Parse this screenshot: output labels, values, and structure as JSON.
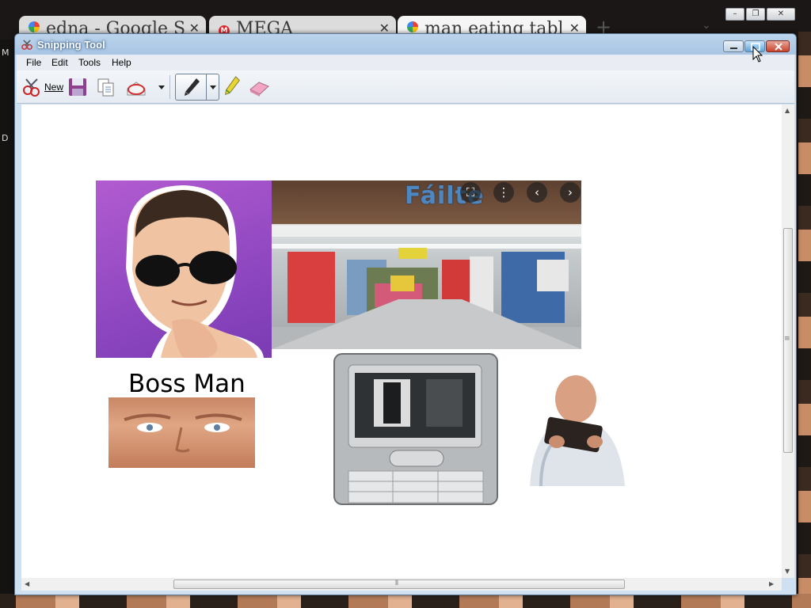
{
  "browser": {
    "tabs": [
      {
        "label": "edna - Google S",
        "icon": "google-icon"
      },
      {
        "label": "MEGA",
        "icon": "mega-icon"
      },
      {
        "label": "man eating tabl",
        "icon": "google-icon",
        "active": true
      }
    ],
    "new_tab": "+",
    "side_letters": [
      "M",
      "D"
    ]
  },
  "window": {
    "title": "Snipping Tool",
    "menu": [
      "File",
      "Edit",
      "Tools",
      "Help"
    ],
    "toolbar": {
      "new_label": "New"
    }
  },
  "canvas": {
    "store_sign_text": "Fáilte",
    "boss_caption": "Boss Man"
  },
  "colors": {
    "title_bar": "#a9c5e3",
    "purple_bg": "#9a4fc8",
    "store_sign": "#4e86bf"
  }
}
